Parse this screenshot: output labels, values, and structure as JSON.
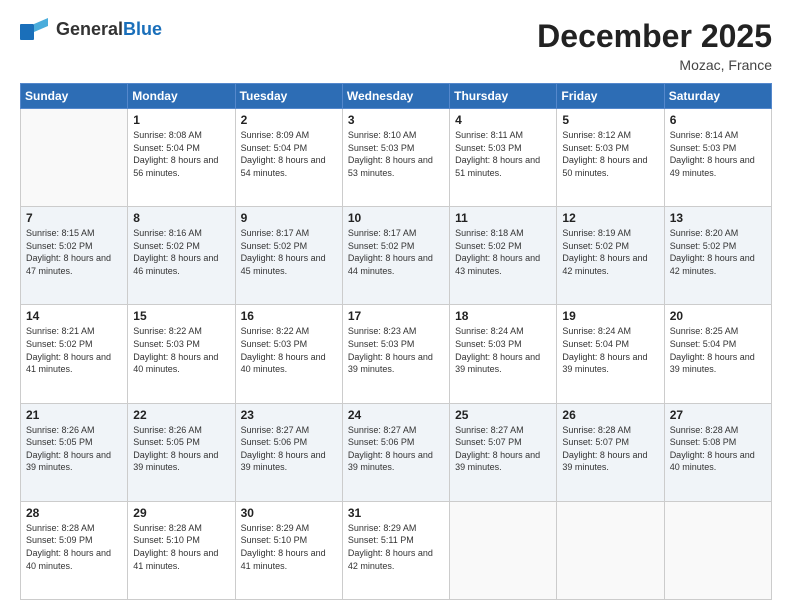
{
  "header": {
    "logo_general": "General",
    "logo_blue": "Blue",
    "month_title": "December 2025",
    "location": "Mozac, France"
  },
  "weekdays": [
    "Sunday",
    "Monday",
    "Tuesday",
    "Wednesday",
    "Thursday",
    "Friday",
    "Saturday"
  ],
  "weeks": [
    [
      {
        "day": "",
        "sunrise": "",
        "sunset": "",
        "daylight": ""
      },
      {
        "day": "1",
        "sunrise": "Sunrise: 8:08 AM",
        "sunset": "Sunset: 5:04 PM",
        "daylight": "Daylight: 8 hours and 56 minutes."
      },
      {
        "day": "2",
        "sunrise": "Sunrise: 8:09 AM",
        "sunset": "Sunset: 5:04 PM",
        "daylight": "Daylight: 8 hours and 54 minutes."
      },
      {
        "day": "3",
        "sunrise": "Sunrise: 8:10 AM",
        "sunset": "Sunset: 5:03 PM",
        "daylight": "Daylight: 8 hours and 53 minutes."
      },
      {
        "day": "4",
        "sunrise": "Sunrise: 8:11 AM",
        "sunset": "Sunset: 5:03 PM",
        "daylight": "Daylight: 8 hours and 51 minutes."
      },
      {
        "day": "5",
        "sunrise": "Sunrise: 8:12 AM",
        "sunset": "Sunset: 5:03 PM",
        "daylight": "Daylight: 8 hours and 50 minutes."
      },
      {
        "day": "6",
        "sunrise": "Sunrise: 8:14 AM",
        "sunset": "Sunset: 5:03 PM",
        "daylight": "Daylight: 8 hours and 49 minutes."
      }
    ],
    [
      {
        "day": "7",
        "sunrise": "Sunrise: 8:15 AM",
        "sunset": "Sunset: 5:02 PM",
        "daylight": "Daylight: 8 hours and 47 minutes."
      },
      {
        "day": "8",
        "sunrise": "Sunrise: 8:16 AM",
        "sunset": "Sunset: 5:02 PM",
        "daylight": "Daylight: 8 hours and 46 minutes."
      },
      {
        "day": "9",
        "sunrise": "Sunrise: 8:17 AM",
        "sunset": "Sunset: 5:02 PM",
        "daylight": "Daylight: 8 hours and 45 minutes."
      },
      {
        "day": "10",
        "sunrise": "Sunrise: 8:17 AM",
        "sunset": "Sunset: 5:02 PM",
        "daylight": "Daylight: 8 hours and 44 minutes."
      },
      {
        "day": "11",
        "sunrise": "Sunrise: 8:18 AM",
        "sunset": "Sunset: 5:02 PM",
        "daylight": "Daylight: 8 hours and 43 minutes."
      },
      {
        "day": "12",
        "sunrise": "Sunrise: 8:19 AM",
        "sunset": "Sunset: 5:02 PM",
        "daylight": "Daylight: 8 hours and 42 minutes."
      },
      {
        "day": "13",
        "sunrise": "Sunrise: 8:20 AM",
        "sunset": "Sunset: 5:02 PM",
        "daylight": "Daylight: 8 hours and 42 minutes."
      }
    ],
    [
      {
        "day": "14",
        "sunrise": "Sunrise: 8:21 AM",
        "sunset": "Sunset: 5:02 PM",
        "daylight": "Daylight: 8 hours and 41 minutes."
      },
      {
        "day": "15",
        "sunrise": "Sunrise: 8:22 AM",
        "sunset": "Sunset: 5:03 PM",
        "daylight": "Daylight: 8 hours and 40 minutes."
      },
      {
        "day": "16",
        "sunrise": "Sunrise: 8:22 AM",
        "sunset": "Sunset: 5:03 PM",
        "daylight": "Daylight: 8 hours and 40 minutes."
      },
      {
        "day": "17",
        "sunrise": "Sunrise: 8:23 AM",
        "sunset": "Sunset: 5:03 PM",
        "daylight": "Daylight: 8 hours and 39 minutes."
      },
      {
        "day": "18",
        "sunrise": "Sunrise: 8:24 AM",
        "sunset": "Sunset: 5:03 PM",
        "daylight": "Daylight: 8 hours and 39 minutes."
      },
      {
        "day": "19",
        "sunrise": "Sunrise: 8:24 AM",
        "sunset": "Sunset: 5:04 PM",
        "daylight": "Daylight: 8 hours and 39 minutes."
      },
      {
        "day": "20",
        "sunrise": "Sunrise: 8:25 AM",
        "sunset": "Sunset: 5:04 PM",
        "daylight": "Daylight: 8 hours and 39 minutes."
      }
    ],
    [
      {
        "day": "21",
        "sunrise": "Sunrise: 8:26 AM",
        "sunset": "Sunset: 5:05 PM",
        "daylight": "Daylight: 8 hours and 39 minutes."
      },
      {
        "day": "22",
        "sunrise": "Sunrise: 8:26 AM",
        "sunset": "Sunset: 5:05 PM",
        "daylight": "Daylight: 8 hours and 39 minutes."
      },
      {
        "day": "23",
        "sunrise": "Sunrise: 8:27 AM",
        "sunset": "Sunset: 5:06 PM",
        "daylight": "Daylight: 8 hours and 39 minutes."
      },
      {
        "day": "24",
        "sunrise": "Sunrise: 8:27 AM",
        "sunset": "Sunset: 5:06 PM",
        "daylight": "Daylight: 8 hours and 39 minutes."
      },
      {
        "day": "25",
        "sunrise": "Sunrise: 8:27 AM",
        "sunset": "Sunset: 5:07 PM",
        "daylight": "Daylight: 8 hours and 39 minutes."
      },
      {
        "day": "26",
        "sunrise": "Sunrise: 8:28 AM",
        "sunset": "Sunset: 5:07 PM",
        "daylight": "Daylight: 8 hours and 39 minutes."
      },
      {
        "day": "27",
        "sunrise": "Sunrise: 8:28 AM",
        "sunset": "Sunset: 5:08 PM",
        "daylight": "Daylight: 8 hours and 40 minutes."
      }
    ],
    [
      {
        "day": "28",
        "sunrise": "Sunrise: 8:28 AM",
        "sunset": "Sunset: 5:09 PM",
        "daylight": "Daylight: 8 hours and 40 minutes."
      },
      {
        "day": "29",
        "sunrise": "Sunrise: 8:28 AM",
        "sunset": "Sunset: 5:10 PM",
        "daylight": "Daylight: 8 hours and 41 minutes."
      },
      {
        "day": "30",
        "sunrise": "Sunrise: 8:29 AM",
        "sunset": "Sunset: 5:10 PM",
        "daylight": "Daylight: 8 hours and 41 minutes."
      },
      {
        "day": "31",
        "sunrise": "Sunrise: 8:29 AM",
        "sunset": "Sunset: 5:11 PM",
        "daylight": "Daylight: 8 hours and 42 minutes."
      },
      {
        "day": "",
        "sunrise": "",
        "sunset": "",
        "daylight": ""
      },
      {
        "day": "",
        "sunrise": "",
        "sunset": "",
        "daylight": ""
      },
      {
        "day": "",
        "sunrise": "",
        "sunset": "",
        "daylight": ""
      }
    ]
  ]
}
